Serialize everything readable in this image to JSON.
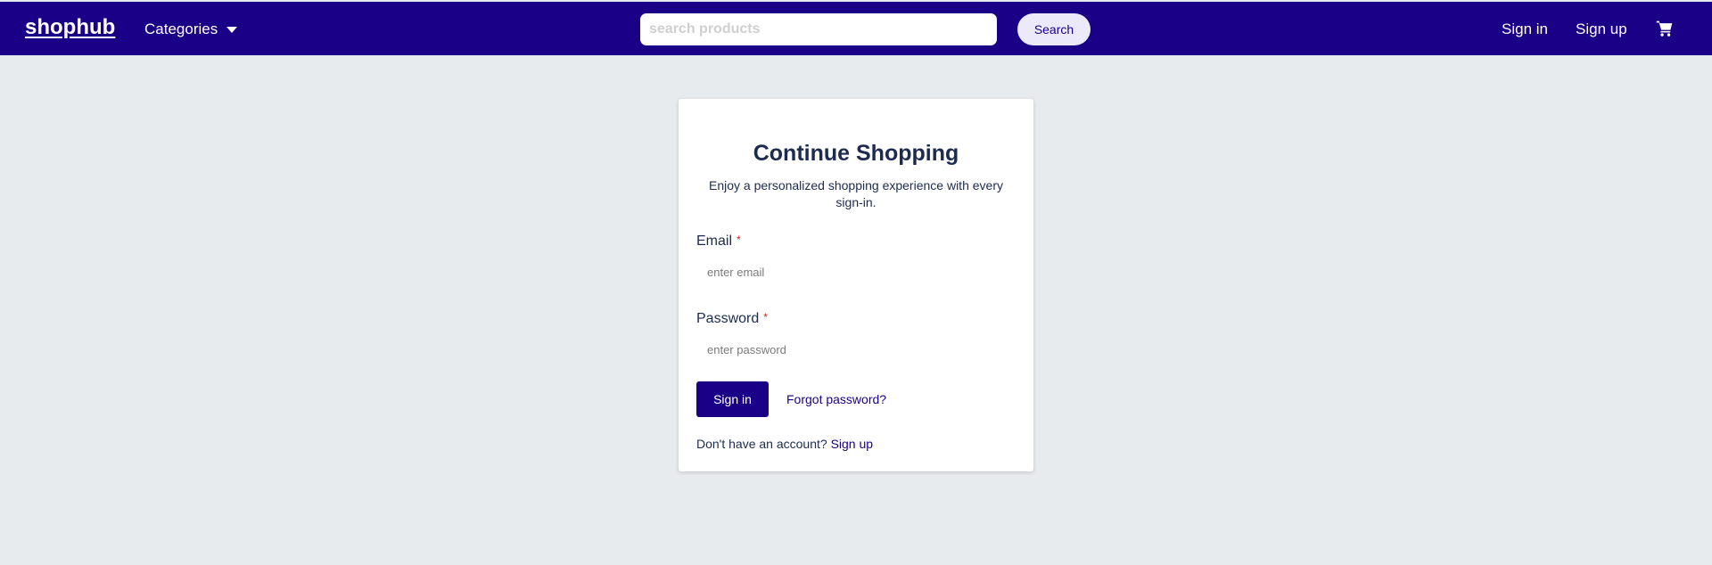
{
  "navbar": {
    "logo": "shophub",
    "categories_label": "Categories",
    "search_placeholder": "search products",
    "search_button": "Search",
    "signin_link": "Sign in",
    "signup_link": "Sign up",
    "cart_icon": "shopping-cart-icon",
    "background_color": "#1a0087"
  },
  "signin_card": {
    "title": "Continue Shopping",
    "subtitle": "Enjoy a personalized shopping experience with every sign-in.",
    "email_label": "Email",
    "email_placeholder": "enter email",
    "password_label": "Password",
    "password_placeholder": "enter password",
    "required_marker": "*",
    "signin_button": "Sign in",
    "forgot_password": "Forgot password?",
    "no_account_text": "Don't have an account?",
    "signup_link": "Sign up"
  }
}
